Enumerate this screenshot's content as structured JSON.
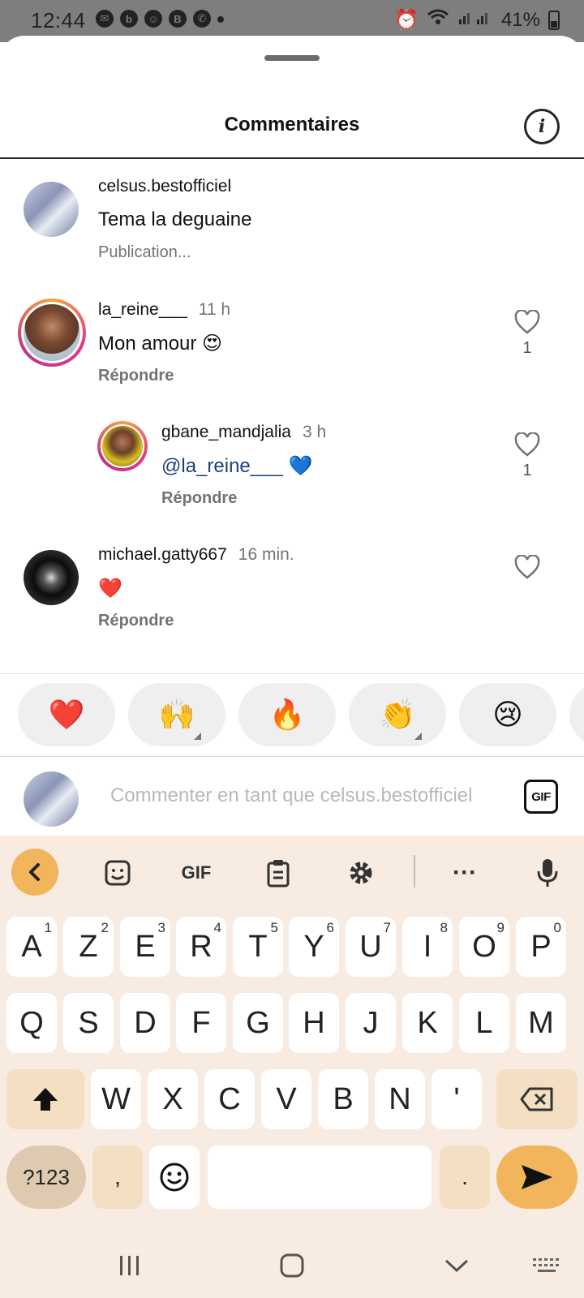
{
  "status_bar": {
    "time": "12:44",
    "notif_icons": [
      "message-icon",
      "b-circle-icon",
      "snapchat-icon",
      "b-badge-icon",
      "whatsapp-icon"
    ],
    "battery": "41%"
  },
  "sheet": {
    "title": "Commentaires"
  },
  "comments": [
    {
      "username": "celsus.bestofficiel",
      "time": "",
      "text": "Tema la deguaine",
      "sub": "Publication..."
    },
    {
      "username": "la_reine___",
      "time": "11 h",
      "text": "Mon amour 😍",
      "reply_label": "Répondre",
      "likes": "1"
    },
    {
      "username": "gbane_mandjalia",
      "time": "3 h",
      "mention": "@la_reine___",
      "text_after": " 💙",
      "reply_label": "Répondre",
      "likes": "1"
    },
    {
      "username": "michael.gatty667",
      "time": "16 min.",
      "text": "❤️",
      "reply_label": "Répondre"
    }
  ],
  "quick_emojis": [
    "❤️",
    "🙌",
    "🔥",
    "👏",
    "😢"
  ],
  "input": {
    "placeholder": "Commenter en tant que celsus.bestofficiel",
    "gif_label": "GIF"
  },
  "keyboard": {
    "toolbar_gif": "GIF",
    "row1": [
      "A",
      "Z",
      "E",
      "R",
      "T",
      "Y",
      "U",
      "I",
      "O",
      "P"
    ],
    "row1_nums": [
      "1",
      "2",
      "3",
      "4",
      "5",
      "6",
      "7",
      "8",
      "9",
      "0"
    ],
    "row2": [
      "Q",
      "S",
      "D",
      "F",
      "G",
      "H",
      "J",
      "K",
      "L",
      "M"
    ],
    "row3": [
      "W",
      "X",
      "C",
      "V",
      "B",
      "N",
      "'"
    ],
    "symbols_label": "?123",
    "comma": ",",
    "period": "."
  },
  "colors": {
    "accent_key": "#f2b55b",
    "keyboard_bg": "#f7ebe2",
    "mention": "#1d3f7a"
  }
}
